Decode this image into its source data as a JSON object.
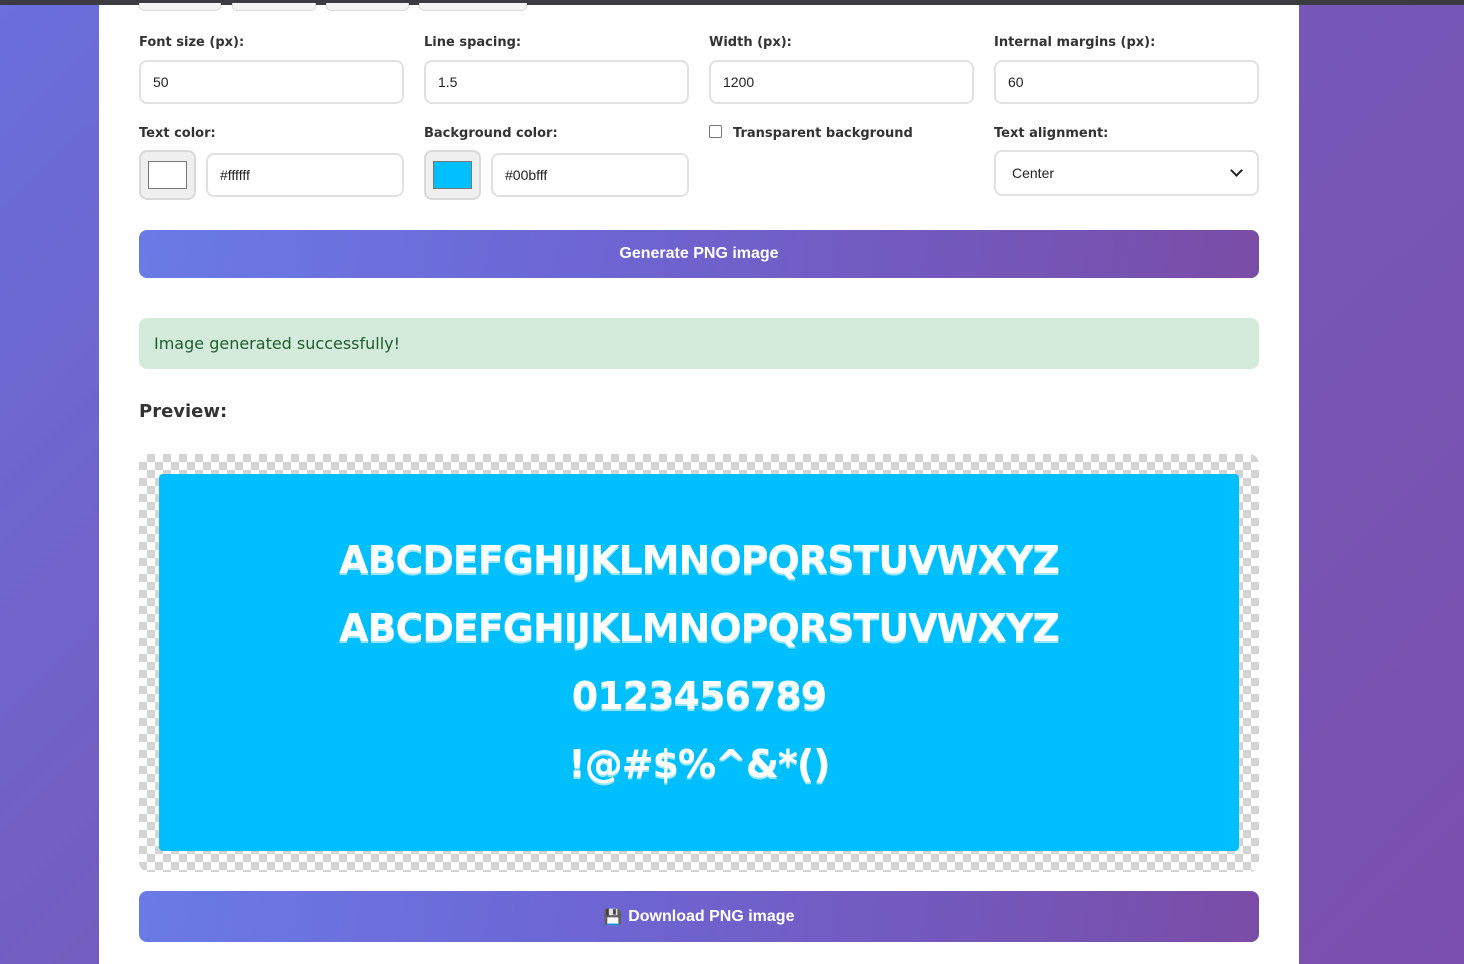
{
  "form": {
    "font_size": {
      "label": "Font size (px):",
      "value": "50"
    },
    "line_spacing": {
      "label": "Line spacing:",
      "value": "1.5"
    },
    "width": {
      "label": "Width (px):",
      "value": "1200"
    },
    "margins": {
      "label": "Internal margins (px):",
      "value": "60"
    },
    "text_color": {
      "label": "Text color:",
      "value": "#ffffff",
      "swatch": "#ffffff"
    },
    "background_color": {
      "label": "Background color:",
      "value": "#00bfff",
      "swatch": "#00bfff"
    },
    "transparent": {
      "label": "Transparent background",
      "checked": false
    },
    "alignment": {
      "label": "Text alignment:",
      "selected": "Center"
    }
  },
  "generate_button": "Generate PNG image",
  "success_message": "Image generated successfully!",
  "preview": {
    "title": "Preview:",
    "background": "#00bfff",
    "text_color": "#ffffff",
    "lines": [
      "ABCDEFGHIJKLMNOPQRSTUVWXYZ",
      "ABCDEFGHIJKLMNOPQRSTUVWXYZ",
      "0123456789",
      "!@#$%^&*()"
    ]
  },
  "download_button": {
    "icon": "floppy-disk-icon",
    "label": "Download PNG image"
  }
}
